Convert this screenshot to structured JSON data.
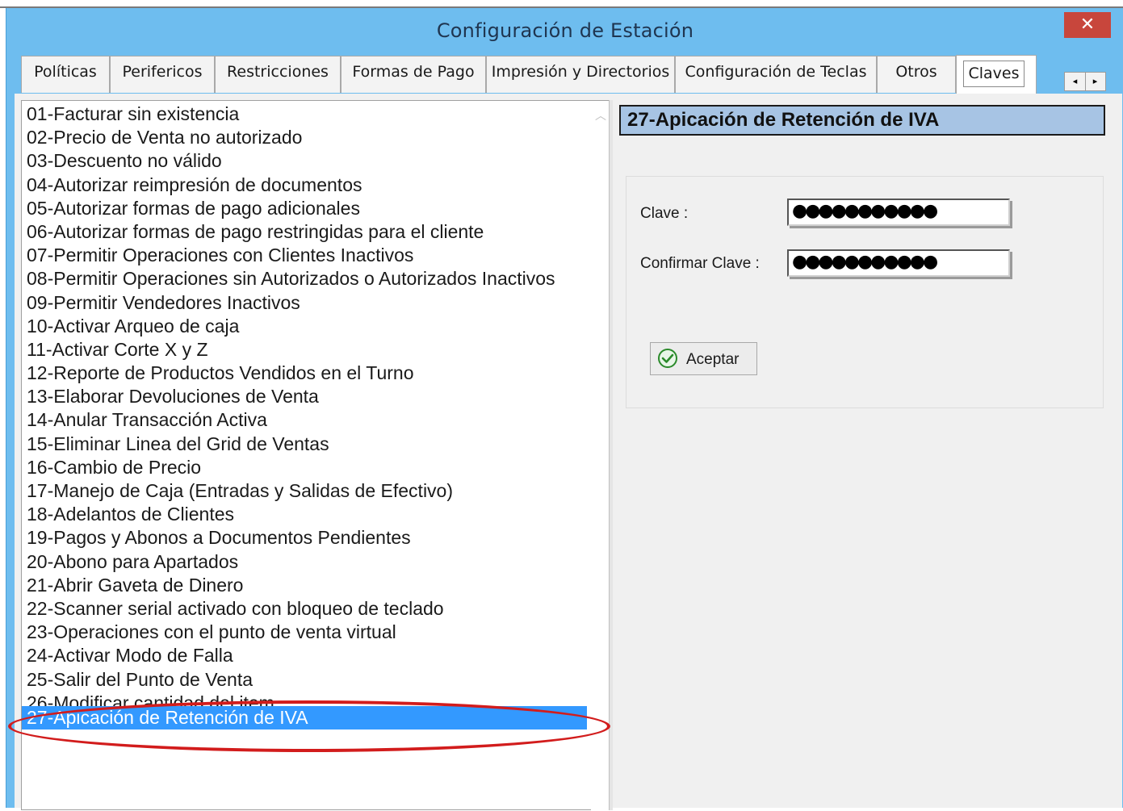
{
  "window": {
    "title": "Configuración de Estación",
    "close_glyph": "✕"
  },
  "tabs": [
    {
      "label": "Políticas"
    },
    {
      "label": "Perifericos"
    },
    {
      "label": "Restricciones"
    },
    {
      "label": "Formas de Pago"
    },
    {
      "label": "Impresión y Directorios"
    },
    {
      "label": "Configuración de Teclas"
    },
    {
      "label": "Otros"
    },
    {
      "label": "Claves",
      "active": true
    }
  ],
  "tab_scroll": {
    "left": "◂",
    "right": "▸"
  },
  "list": {
    "items": [
      "01-Facturar sin existencia",
      "02-Precio de Venta no autorizado",
      "03-Descuento no válido",
      "04-Autorizar reimpresión de documentos",
      "05-Autorizar formas de pago adicionales",
      "06-Autorizar formas de pago restringidas para el cliente",
      "07-Permitir Operaciones con Clientes Inactivos",
      "08-Permitir Operaciones sin Autorizados o Autorizados Inactivos",
      "09-Permitir Vendedores Inactivos",
      "10-Activar Arqueo de caja",
      "11-Activar Corte X y Z",
      "12-Reporte de Productos Vendidos en el Turno",
      "13-Elaborar Devoluciones de Venta",
      "14-Anular Transacción Activa",
      "15-Eliminar Linea del Grid de Ventas",
      "16-Cambio de Precio",
      "17-Manejo de Caja (Entradas y Salidas de Efectivo)",
      "18-Adelantos de Clientes",
      "19-Pagos y Abonos a Documentos Pendientes",
      "20-Abono para Apartados",
      "21-Abrir Gaveta de Dinero",
      "22-Scanner serial activado con bloqueo de teclado",
      "23-Operaciones con el punto de venta virtual",
      "24-Activar Modo de  Falla",
      "25-Salir del Punto de Venta",
      "26-Modificar cantidad del item",
      "27-Apicación de Retención de IVA"
    ],
    "selected_index": 26
  },
  "detail": {
    "header": "27-Apicación de Retención de IVA",
    "clave_label": "Clave :",
    "clave_value": "●●●●●●●●●●●",
    "confirmar_label": "Confirmar Clave :",
    "confirmar_value": "●●●●●●●●●●●",
    "accept_label": "Aceptar"
  },
  "colors": {
    "titlebar": "#6ebdef",
    "selection": "#3399ff",
    "annotation": "#d21c1c",
    "header_bg": "#a7c4e4"
  }
}
